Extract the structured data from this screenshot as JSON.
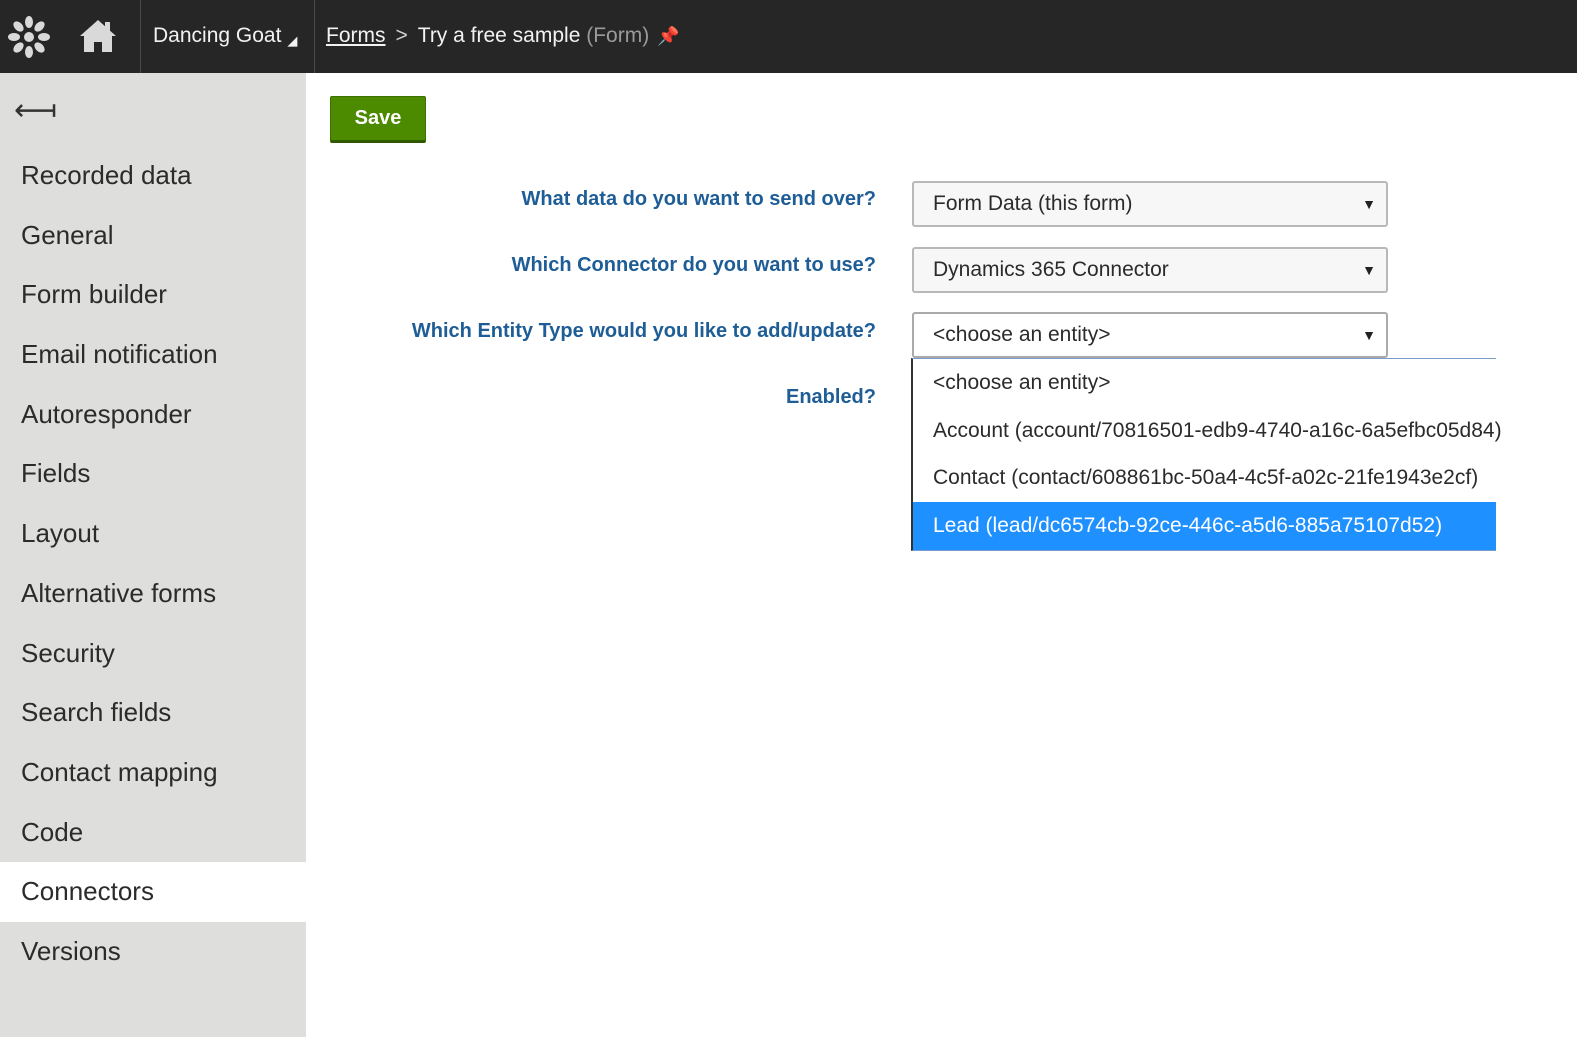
{
  "header": {
    "site_name": "Dancing Goat",
    "site_caret": "◢",
    "breadcrumb_root": "Forms",
    "breadcrumb_separator": ">",
    "breadcrumb_current": "Try a free sample",
    "breadcrumb_type": "(Form)",
    "pin_icon": "📌"
  },
  "sidebar": {
    "back_icon": "⟻",
    "items": [
      {
        "label": "Recorded data"
      },
      {
        "label": "General"
      },
      {
        "label": "Form builder"
      },
      {
        "label": "Email notification"
      },
      {
        "label": "Autoresponder"
      },
      {
        "label": "Fields"
      },
      {
        "label": "Layout"
      },
      {
        "label": "Alternative forms"
      },
      {
        "label": "Security"
      },
      {
        "label": "Search fields"
      },
      {
        "label": "Contact mapping"
      },
      {
        "label": "Code"
      },
      {
        "label": "Connectors"
      },
      {
        "label": "Versions"
      }
    ],
    "active_item": "Connectors"
  },
  "toolbar": {
    "save_label": "Save"
  },
  "form": {
    "data_label": "What data do you want to send over?",
    "data_value": "Form Data (this form)",
    "connector_label": "Which Connector do you want to use?",
    "connector_value": "Dynamics 365 Connector",
    "entity_label": "Which Entity Type would you like to add/update?",
    "entity_value": "<choose an entity>",
    "enabled_label": "Enabled?",
    "select_arrow": "▼"
  },
  "entity_dropdown": {
    "options": [
      {
        "label": "<choose an entity>"
      },
      {
        "label": "Account (account/70816501-edb9-4740-a16c-6a5efbc05d84)"
      },
      {
        "label": "Contact (contact/608861bc-50a4-4c5f-a02c-21fe1943e2cf)"
      },
      {
        "label": "Lead (lead/dc6574cb-92ce-446c-a5d6-885a75107d52)"
      }
    ],
    "highlighted": "Lead (lead/dc6574cb-92ce-446c-a5d6-885a75107d52)"
  },
  "colors": {
    "topbar": "#262626",
    "sidebar": "#dedfdd",
    "save_button": "#4c8a00",
    "label_text": "#1e5d96",
    "highlight": "#1e90ff"
  }
}
